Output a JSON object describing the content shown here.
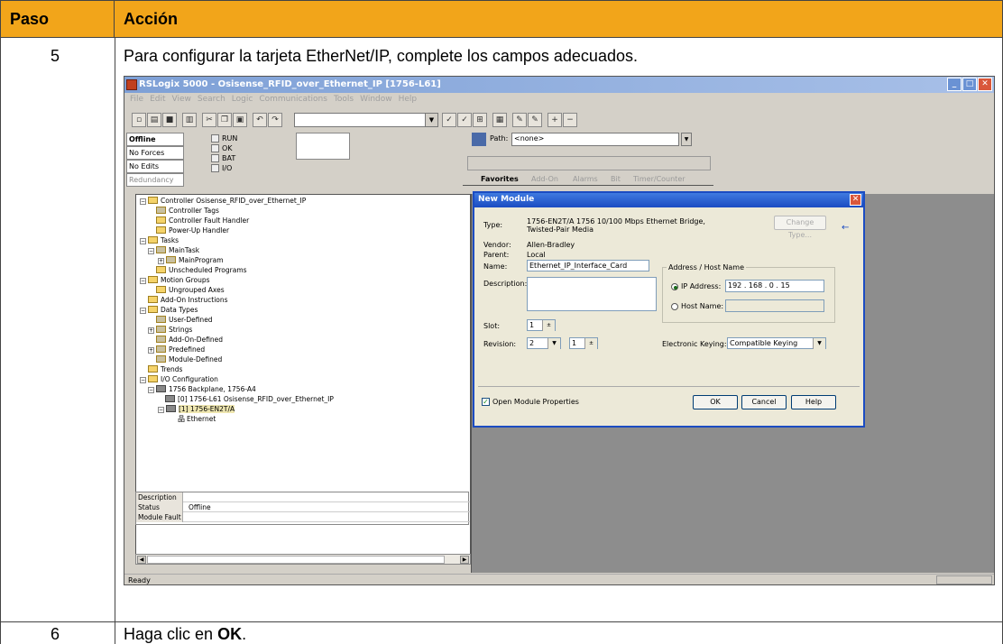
{
  "doc": {
    "col1_header": "Paso",
    "col2_header": "Acción",
    "step5_number": "5",
    "step5_text": "Para configurar la tarjeta EtherNet/IP, complete los campos adecuados.",
    "step6_number": "6",
    "step6_prefix": "Haga clic en ",
    "step6_bold": "OK",
    "step6_suffix": "."
  },
  "window": {
    "title": "RSLogix 5000 - Osisense_RFID_over_Ethernet_IP [1756-L61]",
    "menu": [
      "File",
      "Edit",
      "View",
      "Search",
      "Logic",
      "Communications",
      "Tools",
      "Window",
      "Help"
    ],
    "status_rows": [
      "Offline",
      "No Forces",
      "No Edits",
      "Redundancy"
    ],
    "leds": [
      "RUN",
      "OK",
      "BAT",
      "I/O"
    ],
    "path_label": "Path:",
    "path_value": "<none>",
    "tabs": [
      "Favorites",
      "Add-On",
      "Alarms",
      "Bit",
      "Timer/Counter"
    ],
    "status_bar": "Ready"
  },
  "tree": {
    "items": [
      "Controller Osisense_RFID_over_Ethernet_IP",
      "Controller Tags",
      "Controller Fault Handler",
      "Power-Up Handler",
      "Tasks",
      "MainTask",
      "MainProgram",
      "Unscheduled Programs",
      "Motion Groups",
      "Ungrouped Axes",
      "Add-On Instructions",
      "Data Types",
      "User-Defined",
      "Strings",
      "Add-On-Defined",
      "Predefined",
      "Module-Defined",
      "Trends",
      "I/O Configuration",
      "1756 Backplane, 1756-A4",
      "[0] 1756-L61 Osisense_RFID_over_Ethernet_IP",
      "[1] 1756-EN2T/A",
      "Ethernet"
    ],
    "desc_rows": [
      {
        "key": "Description",
        "value": ""
      },
      {
        "key": "Status",
        "value": "Offline"
      },
      {
        "key": "Module Fault",
        "value": ""
      }
    ]
  },
  "dialog": {
    "title": "New Module",
    "type_label": "Type:",
    "type_value_line1": "1756-EN2T/A 1756 10/100 Mbps Ethernet Bridge,",
    "type_value_line2": "Twisted-Pair Media",
    "change_type_label": "Change Type...",
    "vendor_label": "Vendor:",
    "vendor_value": "Allen-Bradley",
    "parent_label": "Parent:",
    "parent_value": "Local",
    "name_label": "Name:",
    "name_value": "Ethernet_IP_Interface_Card",
    "description_label": "Description:",
    "address_group_label": "Address / Host Name",
    "ip_label": "IP Address:",
    "ip_value": "192 . 168 . 0 . 15",
    "host_label": "Host Name:",
    "slot_label": "Slot:",
    "slot_value": "1",
    "revision_label": "Revision:",
    "revision_major": "2",
    "revision_minor": "1",
    "keying_label": "Electronic Keying:",
    "keying_value": "Compatible Keying",
    "open_props_label": "Open Module Properties",
    "ok_label": "OK",
    "cancel_label": "Cancel",
    "help_label": "Help"
  }
}
